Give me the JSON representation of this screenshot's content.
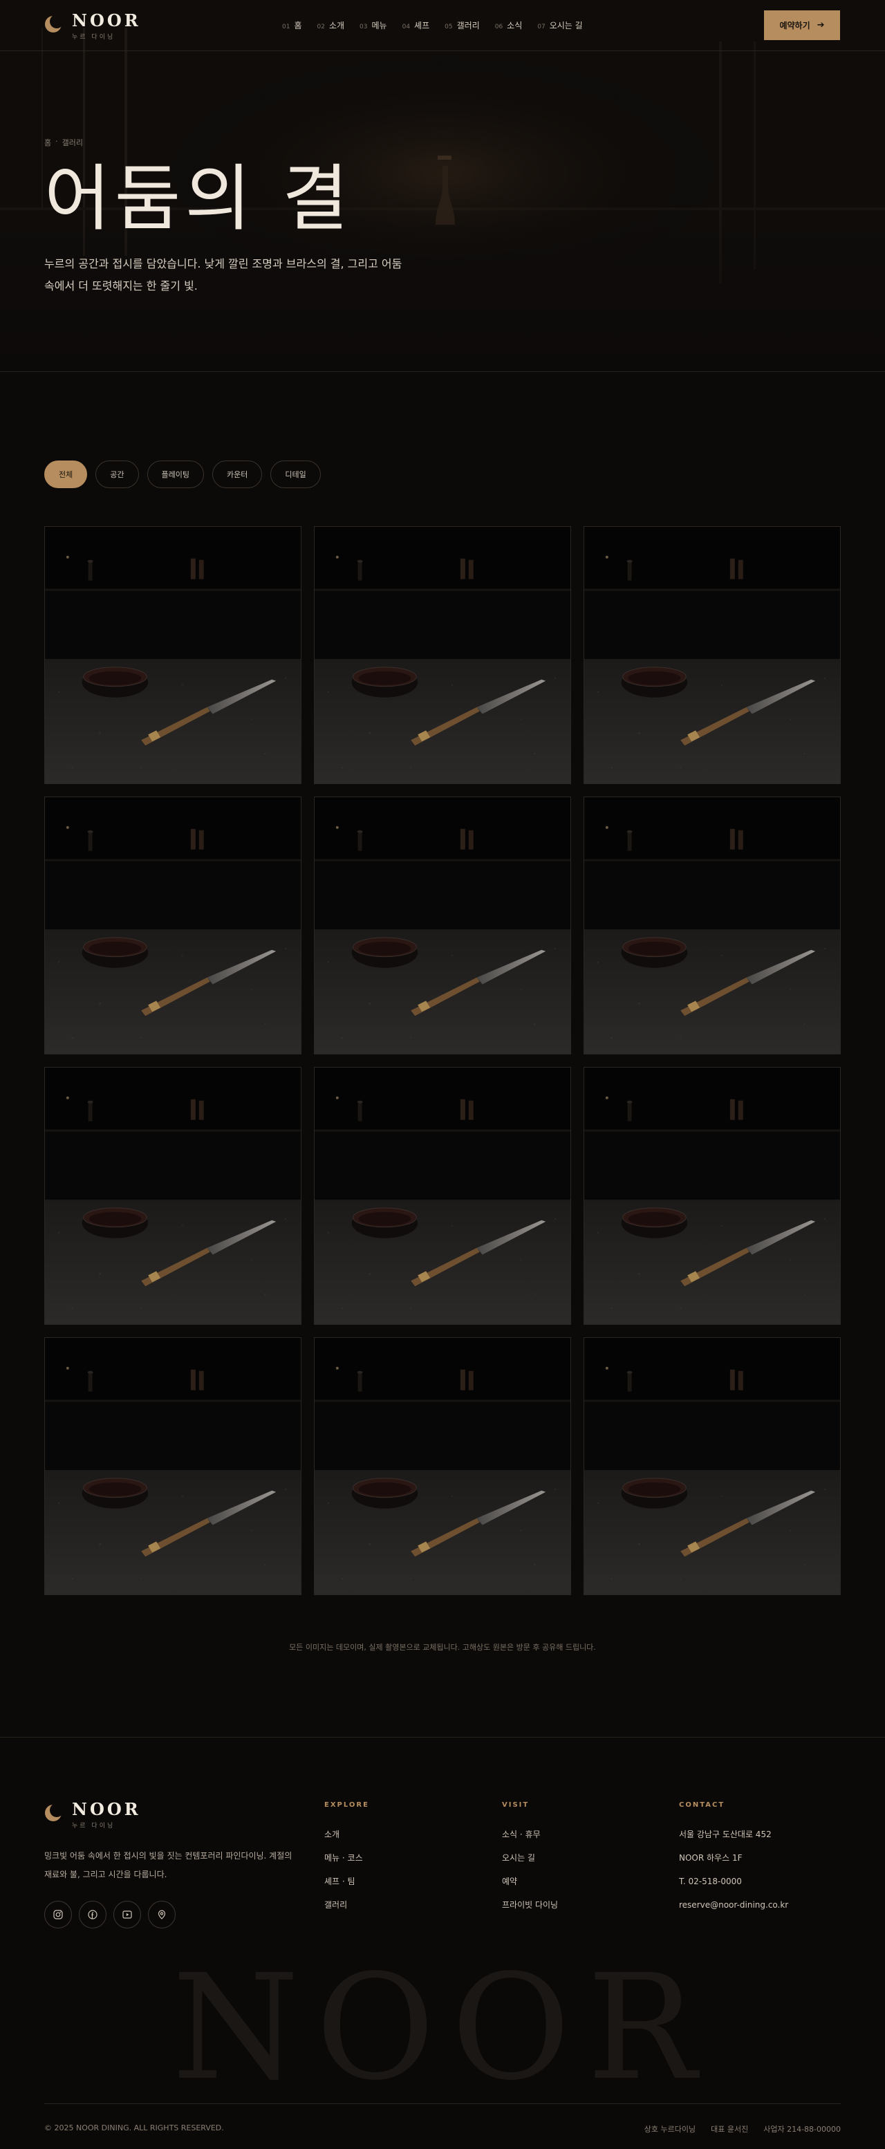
{
  "brand": {
    "name": "NOOR",
    "sub": "누르 다이닝"
  },
  "nav": [
    {
      "num": "01",
      "label": "홈"
    },
    {
      "num": "02",
      "label": "소개"
    },
    {
      "num": "03",
      "label": "메뉴"
    },
    {
      "num": "04",
      "label": "셰프"
    },
    {
      "num": "05",
      "label": "갤러리"
    },
    {
      "num": "06",
      "label": "소식"
    },
    {
      "num": "07",
      "label": "오시는 길"
    }
  ],
  "header": {
    "reserve_label": "예약하기"
  },
  "hero": {
    "breadcrumb_home": "홈",
    "breadcrumb_sep": "·",
    "breadcrumb_current": "갤러리",
    "title": "어둠의 결",
    "description": "누르의 공간과 접시를 담았습니다. 낮게 깔린 조명과 브라스의 결, 그리고 어둠 속에서 더 또렷해지는 한 줄기 빛."
  },
  "filters": [
    "전체",
    "공간",
    "플레이팅",
    "카운터",
    "디테일"
  ],
  "active_filter": "전체",
  "gallery": {
    "tile_count": 12,
    "note": "모든 이미지는 데모이며, 실제 촬영본으로 교체됩니다. 고해상도 원본은 방문 후 공유해 드립니다."
  },
  "footer": {
    "tagline": "밍크빛 어둠 속에서 한 접시의 빛을 짓는 컨템포러리 파인다이닝. 계절의 재료와 불, 그리고 시간을 다룹니다.",
    "socials": [
      "instagram-icon",
      "facebook-icon",
      "youtube-icon",
      "location-pin-icon"
    ],
    "explore": {
      "title": "EXPLORE",
      "links": [
        "소개",
        "메뉴 · 코스",
        "셰프 · 팀",
        "갤러리"
      ]
    },
    "visit": {
      "title": "VISIT",
      "links": [
        "소식 · 휴무",
        "오시는 길",
        "예약",
        "프라이빗 다이닝"
      ]
    },
    "contact": {
      "title": "CONTACT",
      "address1": "서울 강남구 도산대로 452",
      "address2": "NOOR 하우스 1F",
      "phone": "T. 02-518-0000",
      "email": "reserve@noor-dining.co.kr"
    },
    "bigword": "NOOR",
    "copyright": "© 2025 NOOR DINING. ALL RIGHTS RESERVED.",
    "business": [
      "상호 누르다이닝",
      "대표 윤서진",
      "사업자 214-88-00000"
    ]
  },
  "colors": {
    "accent": "#b58d5e",
    "background": "#0c0a09",
    "text": "#e8dfd2"
  }
}
